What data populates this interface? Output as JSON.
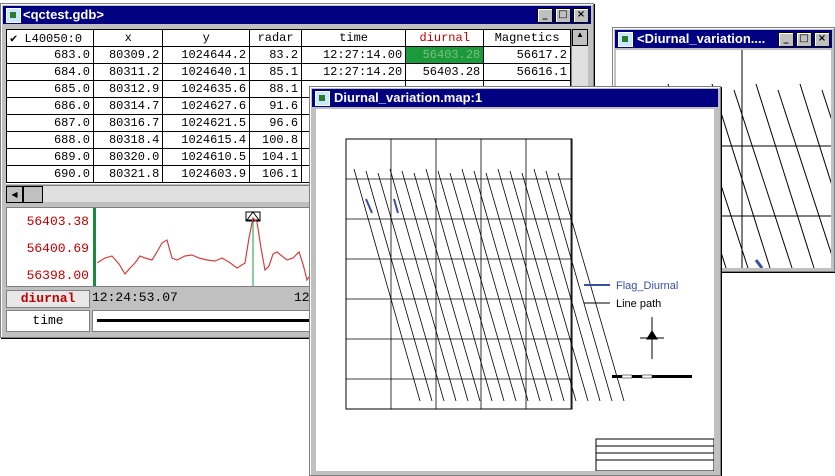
{
  "gdb_window": {
    "title": "<qctest.gdb>",
    "line_selector": "L40050:0",
    "columns": [
      "x",
      "y",
      "radar",
      "time",
      "diurnal",
      "Magnetics"
    ],
    "rows": [
      {
        "fid": "683.0",
        "x": "80309.2",
        "y": "1024644.2",
        "radar": "83.2",
        "time": "12:27:14.00",
        "diurnal": "56403.28",
        "magnetics": "56617.2"
      },
      {
        "fid": "684.0",
        "x": "80311.2",
        "y": "1024640.1",
        "radar": "85.1",
        "time": "12:27:14.20",
        "diurnal": "56403.28",
        "magnetics": "56616.1"
      },
      {
        "fid": "685.0",
        "x": "80312.9",
        "y": "1024635.6",
        "radar": "88.1",
        "time": "",
        "diurnal": "",
        "magnetics": ""
      },
      {
        "fid": "686.0",
        "x": "80314.7",
        "y": "1024627.6",
        "radar": "91.6",
        "time": "",
        "diurnal": "",
        "magnetics": ""
      },
      {
        "fid": "687.0",
        "x": "80316.7",
        "y": "1024621.5",
        "radar": "96.6",
        "time": "",
        "diurnal": "",
        "magnetics": ""
      },
      {
        "fid": "688.0",
        "x": "80318.4",
        "y": "1024615.4",
        "radar": "100.8",
        "time": "",
        "diurnal": "",
        "magnetics": ""
      },
      {
        "fid": "689.0",
        "x": "80320.0",
        "y": "1024610.5",
        "radar": "104.1",
        "time": "",
        "diurnal": "",
        "magnetics": ""
      },
      {
        "fid": "690.0",
        "x": "80321.8",
        "y": "1024603.9",
        "radar": "106.1",
        "time": "",
        "diurnal": "",
        "magnetics": ""
      }
    ],
    "profile_labels": [
      "56403.38",
      "56400.69",
      "56398.00"
    ],
    "footer_channel": "diurnal",
    "footer_value": "12:24:53.07",
    "footer_value2": "12",
    "footer_axis": "time"
  },
  "map_window": {
    "title": "Diurnal_variation.map:1",
    "legend_flag": "Flag_Diurnal",
    "legend_line": "Line path",
    "colors": {
      "flag": "#3a4fa0",
      "line": "#000000"
    }
  },
  "small_window": {
    "title": "<Diurnal_variation...."
  }
}
